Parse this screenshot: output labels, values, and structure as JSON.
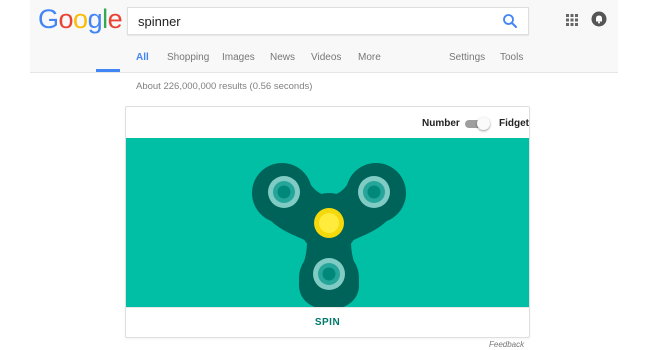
{
  "logo": {
    "letters": [
      "G",
      "o",
      "o",
      "g",
      "l",
      "e"
    ],
    "colors": [
      "#4285f4",
      "#ea4335",
      "#fbbc05",
      "#4285f4",
      "#34a853",
      "#ea4335"
    ]
  },
  "search": {
    "query": "spinner"
  },
  "tabs": [
    {
      "label": "All",
      "active": true
    },
    {
      "label": "Shopping"
    },
    {
      "label": "Images"
    },
    {
      "label": "News"
    },
    {
      "label": "Videos"
    },
    {
      "label": "More"
    },
    {
      "label": "Settings"
    },
    {
      "label": "Tools"
    }
  ],
  "results_stats": "About 226,000,000 results (0.56 seconds)",
  "widget": {
    "toggle_left": "Number",
    "toggle_right": "Fidget",
    "spin_label": "SPIN",
    "stage_color": "#00bfa5",
    "body_color": "#00635a",
    "bearing_color": "#80cbc4",
    "center_color": "#f5d90a"
  },
  "feedback": "Feedback",
  "colors": {
    "accent": "#4285f4"
  }
}
